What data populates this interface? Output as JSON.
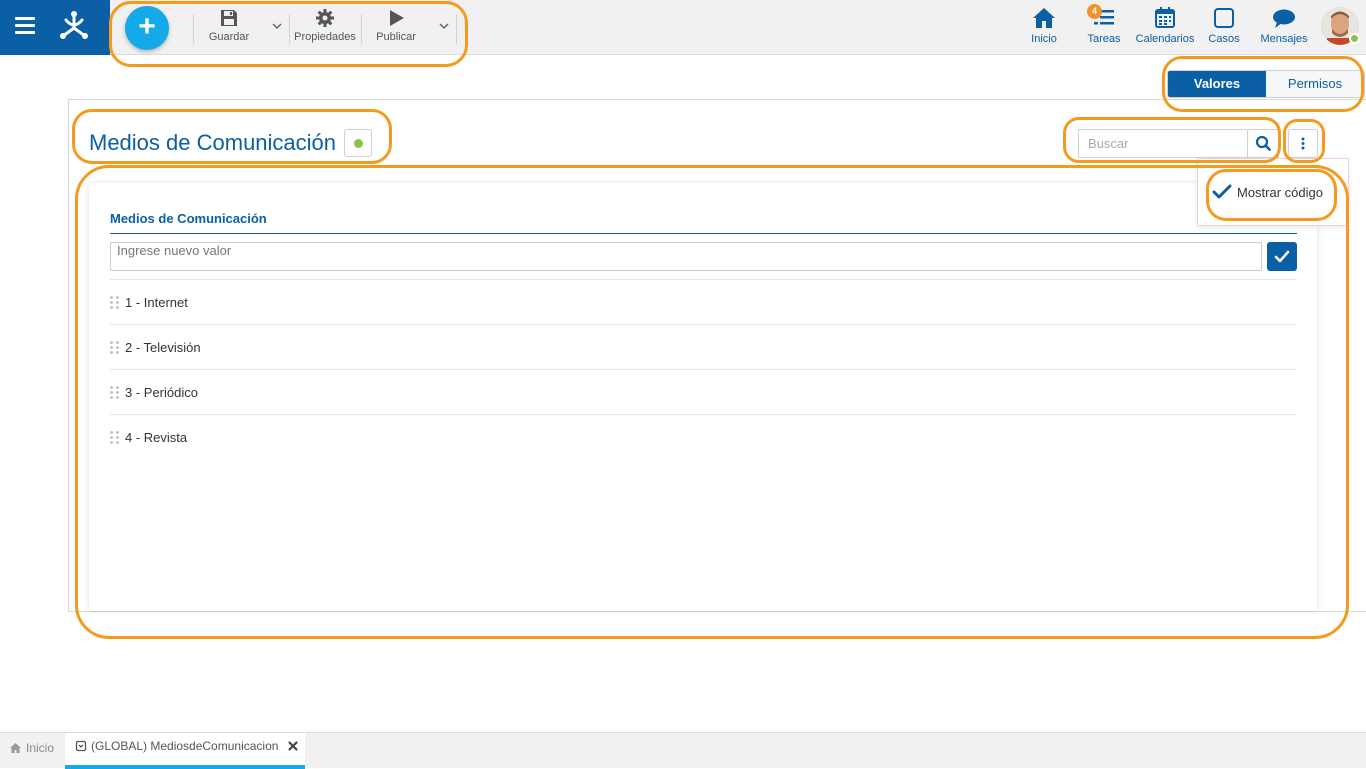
{
  "header": {
    "toolbar": {
      "add_label": "+",
      "save_label": "Guardar",
      "properties_label": "Propiedades",
      "publish_label": "Publicar"
    },
    "nav": {
      "home_label": "Inicio",
      "tasks_label": "Tareas",
      "tasks_badge": "4",
      "calendars_label": "Calendarios",
      "cases_label": "Casos",
      "messages_label": "Mensajes"
    },
    "colors": {
      "brand": "#0b5fa5",
      "add_button": "#14a9e8",
      "badge": "#f0932b",
      "online": "#8bc34a"
    }
  },
  "view_tabs": [
    {
      "label": "Valores",
      "active": true
    },
    {
      "label": "Permisos",
      "active": false
    }
  ],
  "page": {
    "title": "Medios de Comunicación",
    "search_placeholder": "Buscar",
    "menu": {
      "show_code_label": "Mostrar código",
      "show_code_checked": true
    }
  },
  "domain_card": {
    "title": "Medios de Comunicación",
    "new_value_placeholder": "Ingrese nuevo valor",
    "items": [
      {
        "label": "1 - Internet"
      },
      {
        "label": "2 - Televisión"
      },
      {
        "label": "3 - Periódico"
      },
      {
        "label": "4 - Revista"
      }
    ]
  },
  "footer": {
    "home_tab_label": "Inicio",
    "active_tab_label": "(GLOBAL) MediosdeComunicacion"
  },
  "annotation_color": "#f39b1f"
}
